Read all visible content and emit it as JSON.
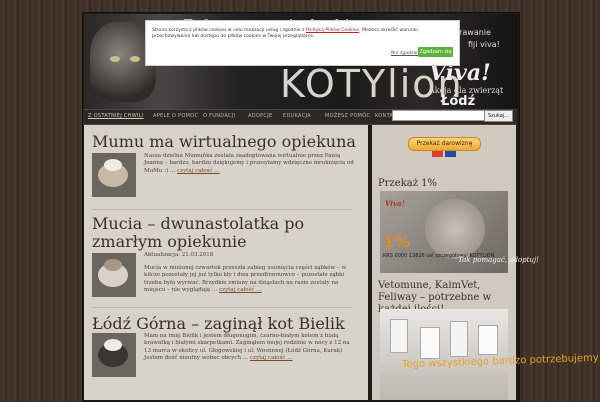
{
  "header": {
    "logo_text": "KOTYlion",
    "logo_top": "Zakręcone nie łaski",
    "viva": "Viva!",
    "viva_sub": "Akcja dla zwierząt",
    "city": "Łódź",
    "side_text1": "w rawanie",
    "side_text2": "fiji viva!"
  },
  "cookie": {
    "text_before": "Strona korzysta z plików cookies w celu realizacji usług i zgodnie z",
    "policy_link": "Polityką Plików Cookies",
    "text_after": ". Możesz określić warunki przechowywania lub dostępu do plików cookies w Twojej przeglądarce.",
    "more_link": "Nie zgadzam się",
    "agree_button": "Zgadzam się"
  },
  "nav": {
    "items": [
      {
        "label": "Z OSTATNIEJ CHWILI",
        "active": true
      },
      {
        "label": "APELE O POMOC"
      },
      {
        "label": "O FUNDACJI"
      },
      {
        "label": "ADOPCJE"
      },
      {
        "label": "EDUKACJA"
      },
      {
        "label": "MOŻESZ POMÓC"
      },
      {
        "label": "KONTAKT"
      }
    ],
    "search_button": "Szukaj..."
  },
  "posts": [
    {
      "title": "Mumu ma wirtualnego opiekuna :)",
      "date": "",
      "excerpt": "Nasza dzielna Mumuńka została zaadoptowana wirtualnie przez Panią Joannę – bardzo, bardzo dziękujemy i przesyłamy wdzięczne mruknięcia od MuMu :) …",
      "more": "czytaj całość …"
    },
    {
      "title": "Mucia – dwunastolatka po zmarłym opiekunie",
      "date": "Aktualizacja: 21.03.2018",
      "excerpt": "Mucia w minionej czwartek przeszła zabieg usunięcia części ząbków – w kilcze pozostały jej już tylko kły i dwa przedtrzonowce – pozostałe ząbki trzeba było wyrwać. Brzydkie zmiany na dziąsłach na razie zostały na miejscu – nie wyglądają …",
      "more": "czytaj całość …"
    },
    {
      "title": "Łódź Górna – zaginął kot Bielik",
      "date": "",
      "excerpt": "Mam na imię Bielik i jestem długonogim, czarno-białym kotem z białą krawatką i białymi skarpetkami. Zaginąłem mojej rodzinie w nocy z 12 na 13 marca w okolicy ul. Głogowskiej i ul. Wosnnnej (Łódź Górna, Kurak) Jestem dość nieufny wobec obcych …",
      "more": "czytaj całość …"
    }
  ],
  "sidebar": {
    "donate_button": "Przekaż darowiznę",
    "heading1": "Przekaż 1%",
    "one_percent": "1%",
    "krs": "KRS 0000 13826 cel szczegółowy: KOTYLION",
    "pomagac": "Tak pomagać, adoptuj!",
    "viva_small": "Viva!",
    "heading2": "Vetomune, KaimVet, Feliway – potrzebne w każdej ilości!",
    "promo": "Tego wszystkiego bardzo potrzebujemy"
  },
  "colors": {
    "page_bg": "#3b2f25",
    "content_bg": "#d7d3cb",
    "title": "#3e2f26",
    "agree": "#5bb33b",
    "donate": "#f0a834"
  }
}
